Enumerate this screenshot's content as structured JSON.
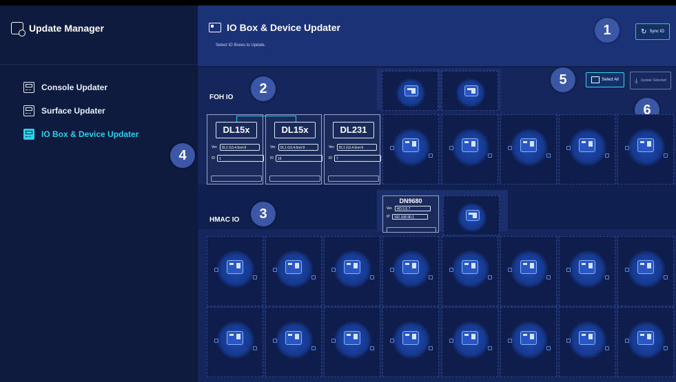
{
  "sidebar": {
    "title": "Update Manager",
    "items": [
      {
        "label": "Console Updater",
        "active": false
      },
      {
        "label": "Surface Updater",
        "active": false
      },
      {
        "label": "IO Box & Device Updater",
        "active": true
      }
    ]
  },
  "header": {
    "title": "IO Box & Device Updater",
    "subtitle": "Select IO Boxes to Update.",
    "sync_label": "Sync IO"
  },
  "toolbar": {
    "select_all_label": "Select All",
    "update_selected_label": "Update Selected"
  },
  "sections": {
    "foh_label": "FOH IO",
    "hmac_label": "HMAC IO"
  },
  "foh_cards": [
    {
      "name": "DL15x",
      "ver_label": "Ver.",
      "ver": "DL1 G3.4.6rel-9",
      "id_label": "ID",
      "id": "1"
    },
    {
      "name": "DL15x",
      "ver_label": "Ver.",
      "ver": "DL1 G3.4.6rel-9",
      "id_label": "ID",
      "id": "16"
    },
    {
      "name": "DL231",
      "ver_label": "Ver.",
      "ver": "DL1 G3.4.6rel-9",
      "id_label": "ID",
      "id": "7"
    }
  ],
  "hmac_card": {
    "name": "DN9680",
    "ver_label": "Ver.",
    "ver": "HD 0.0.7",
    "ip_label": "IP",
    "ip": "192.168.90.1"
  },
  "badges": [
    "1",
    "2",
    "3",
    "4",
    "5",
    "6"
  ],
  "colors": {
    "accent": "#29d3ea",
    "sync_border": "#3fd15a",
    "header_bg": "#1b3277",
    "sidebar_bg": "#0e1a3e"
  }
}
